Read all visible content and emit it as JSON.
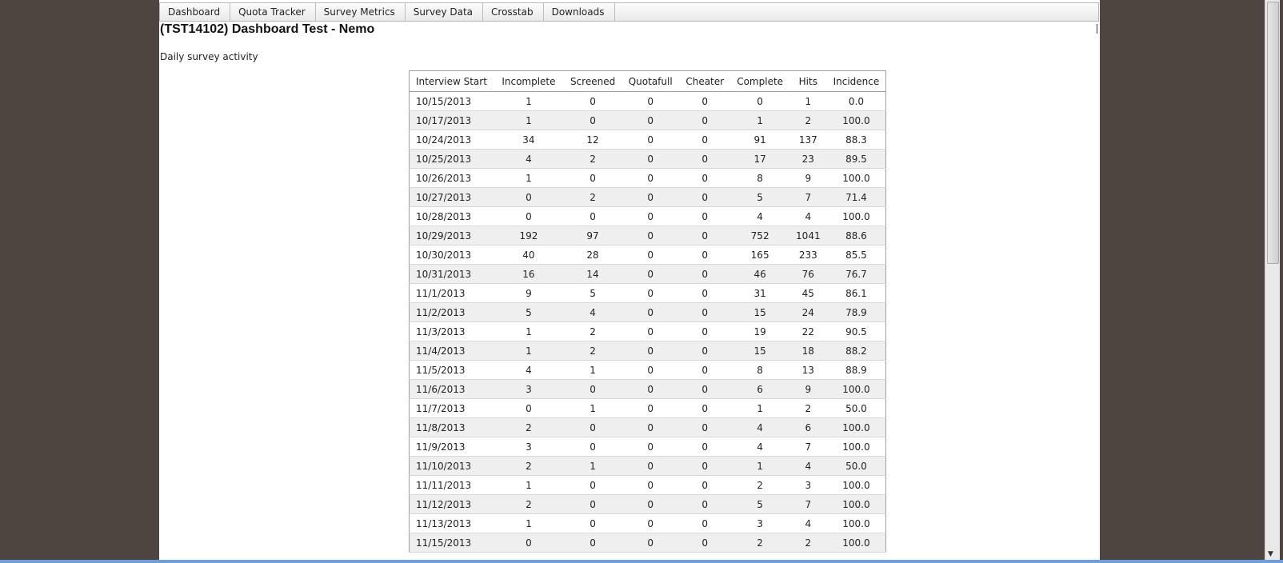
{
  "nav": {
    "tabs": [
      "Dashboard",
      "Quota Tracker",
      "Survey Metrics",
      "Survey Data",
      "Crosstab",
      "Downloads"
    ]
  },
  "page": {
    "title": "(TST14102) Dashboard Test - Nemo",
    "subtitle": "Daily survey activity"
  },
  "table": {
    "headers": [
      "Interview Start",
      "Incomplete",
      "Screened",
      "Quotafull",
      "Cheater",
      "Complete",
      "Hits",
      "Incidence"
    ],
    "rows": [
      [
        "10/15/2013",
        "1",
        "0",
        "0",
        "0",
        "0",
        "1",
        "0.0"
      ],
      [
        "10/17/2013",
        "1",
        "0",
        "0",
        "0",
        "1",
        "2",
        "100.0"
      ],
      [
        "10/24/2013",
        "34",
        "12",
        "0",
        "0",
        "91",
        "137",
        "88.3"
      ],
      [
        "10/25/2013",
        "4",
        "2",
        "0",
        "0",
        "17",
        "23",
        "89.5"
      ],
      [
        "10/26/2013",
        "1",
        "0",
        "0",
        "0",
        "8",
        "9",
        "100.0"
      ],
      [
        "10/27/2013",
        "0",
        "2",
        "0",
        "0",
        "5",
        "7",
        "71.4"
      ],
      [
        "10/28/2013",
        "0",
        "0",
        "0",
        "0",
        "4",
        "4",
        "100.0"
      ],
      [
        "10/29/2013",
        "192",
        "97",
        "0",
        "0",
        "752",
        "1041",
        "88.6"
      ],
      [
        "10/30/2013",
        "40",
        "28",
        "0",
        "0",
        "165",
        "233",
        "85.5"
      ],
      [
        "10/31/2013",
        "16",
        "14",
        "0",
        "0",
        "46",
        "76",
        "76.7"
      ],
      [
        "11/1/2013",
        "9",
        "5",
        "0",
        "0",
        "31",
        "45",
        "86.1"
      ],
      [
        "11/2/2013",
        "5",
        "4",
        "0",
        "0",
        "15",
        "24",
        "78.9"
      ],
      [
        "11/3/2013",
        "1",
        "2",
        "0",
        "0",
        "19",
        "22",
        "90.5"
      ],
      [
        "11/4/2013",
        "1",
        "2",
        "0",
        "0",
        "15",
        "18",
        "88.2"
      ],
      [
        "11/5/2013",
        "4",
        "1",
        "0",
        "0",
        "8",
        "13",
        "88.9"
      ],
      [
        "11/6/2013",
        "3",
        "0",
        "0",
        "0",
        "6",
        "9",
        "100.0"
      ],
      [
        "11/7/2013",
        "0",
        "1",
        "0",
        "0",
        "1",
        "2",
        "50.0"
      ],
      [
        "11/8/2013",
        "2",
        "0",
        "0",
        "0",
        "4",
        "6",
        "100.0"
      ],
      [
        "11/9/2013",
        "3",
        "0",
        "0",
        "0",
        "4",
        "7",
        "100.0"
      ],
      [
        "11/10/2013",
        "2",
        "1",
        "0",
        "0",
        "1",
        "4",
        "50.0"
      ],
      [
        "11/11/2013",
        "1",
        "0",
        "0",
        "0",
        "2",
        "3",
        "100.0"
      ],
      [
        "11/12/2013",
        "2",
        "0",
        "0",
        "0",
        "5",
        "7",
        "100.0"
      ],
      [
        "11/13/2013",
        "1",
        "0",
        "0",
        "0",
        "3",
        "4",
        "100.0"
      ],
      [
        "11/15/2013",
        "0",
        "0",
        "0",
        "0",
        "2",
        "2",
        "100.0"
      ]
    ]
  },
  "colors": {
    "page_background": "#ffffff",
    "desktop_background": "#4e4540",
    "alt_row": "#efefef"
  }
}
